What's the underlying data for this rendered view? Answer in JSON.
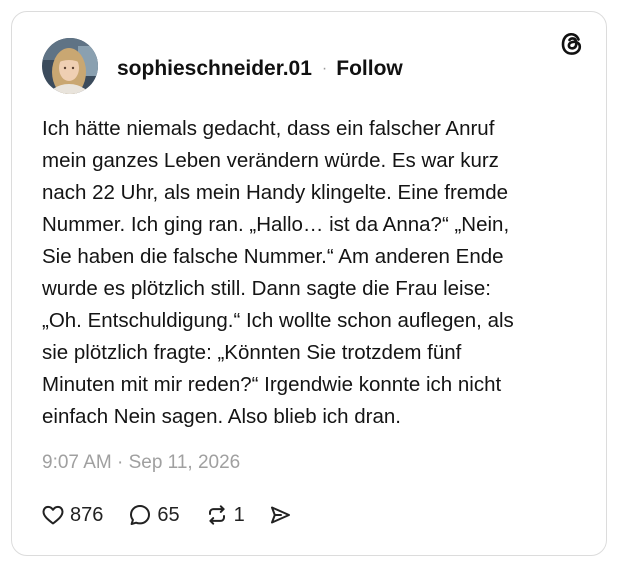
{
  "post": {
    "username": "sophieschneider.01",
    "separator": "·",
    "follow_label": "Follow",
    "text_lines": [
      "Ich hätte niemals gedacht, dass ein falscher Anruf",
      "mein ganzes Leben verändern würde. Es war kurz",
      "nach 22 Uhr, als mein Handy klingelte. Eine fremde",
      "Nummer. Ich ging ran. „Hallo… ist da Anna?“ „Nein,",
      "Sie haben die falsche Nummer.“ Am anderen Ende",
      "wurde es plötzlich still. Dann sagte die Frau leise:",
      "„Oh. Entschuldigung.“ Ich wollte schon auflegen, als",
      "sie plötzlich fragte: „Könnten Sie trotzdem fünf",
      "Minuten mit mir reden?“ Irgendwie konnte ich nicht",
      "einfach Nein sagen. Also blieb ich dran."
    ],
    "timestamp": "9:07 AM · Sep 11, 2026",
    "stats": {
      "likes": "876",
      "replies": "65",
      "reposts": "1"
    }
  },
  "icons": {
    "brand": "threads-logo-icon",
    "like": "heart-icon",
    "reply": "comment-bubble-icon",
    "repost": "repost-arrows-icon",
    "share": "send-paper-plane-icon"
  },
  "colors": {
    "text": "#141414",
    "muted": "#a0a0a0",
    "border": "#dcdcdc",
    "background": "#ffffff"
  }
}
